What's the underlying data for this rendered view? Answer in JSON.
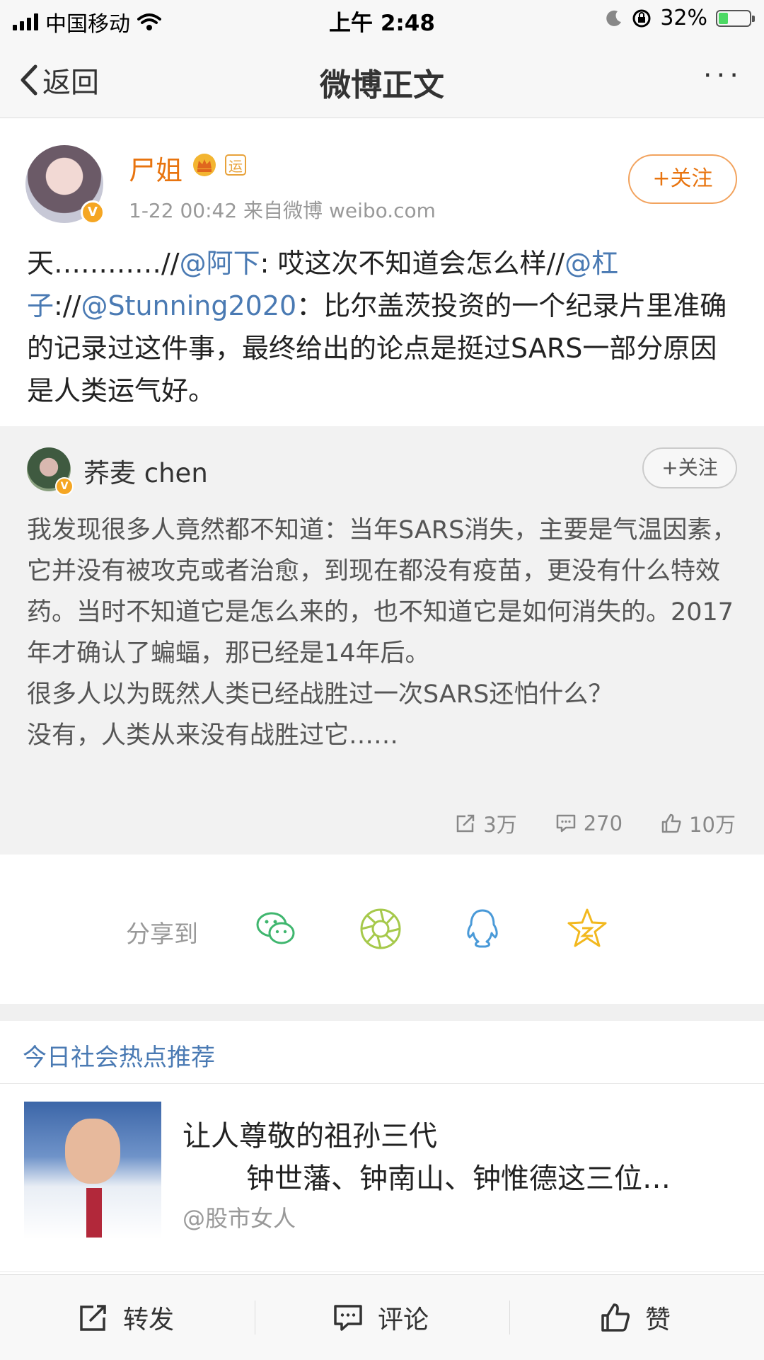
{
  "status": {
    "carrier": "中国移动",
    "time": "上午 2:48",
    "battery": "32%",
    "battery_level": 0.32
  },
  "nav": {
    "back_label": "返回",
    "title": "微博正文",
    "more_label": "···"
  },
  "post": {
    "author": "尸姐",
    "verified_badge": "V",
    "yun_badge": "运",
    "meta": "1-22 00:42  来自微博 weibo.com",
    "follow_label": "+关注",
    "text_parts": [
      {
        "t": "天…………//",
        "m": false
      },
      {
        "t": "@阿下",
        "m": true
      },
      {
        "t": ": 哎这次不知道会怎么样//",
        "m": false
      },
      {
        "t": "@杠子",
        "m": true
      },
      {
        "t": "://",
        "m": false
      },
      {
        "t": "@Stunning2020",
        "m": true
      },
      {
        "t": "：比尔盖茨投资的一个纪录片里准确的记录过这件事，最终给出的论点是挺过SARS一部分原因是人类运气好。",
        "m": false
      }
    ]
  },
  "retweet": {
    "author": "荞麦 chen",
    "follow_label": "+关注",
    "text": "我发现很多人竟然都不知道：当年SARS消失，主要是气温因素，它并没有被攻克或者治愈，到现在都没有疫苗，更没有什么特效药。当时不知道它是怎么来的，也不知道它是如何消失的。2017年才确认了蝙蝠，那已经是14年后。\n很多人以为既然人类已经战胜过一次SARS还怕什么？\n没有，人类从来没有战胜过它……",
    "reposts": "3万",
    "comments": "270",
    "likes": "10万"
  },
  "share": {
    "label": "分享到",
    "targets": [
      "wechat-icon",
      "moments-icon",
      "qq-icon",
      "qzone-icon"
    ]
  },
  "recommend": {
    "header": "今日社会热点推荐",
    "title": "让人尊敬的祖孙三代",
    "subtitle": "钟世藩、钟南山、钟惟德这三位…",
    "author": "@股市女人"
  },
  "toolbar": {
    "repost": "转发",
    "comment": "评论",
    "like": "赞"
  },
  "colors": {
    "accent_orange": "#e8740f",
    "link_blue": "#4a7ab3",
    "wechat_green": "#3fb66e",
    "moments_green": "#a6c94b",
    "qq_blue": "#4a9ad8",
    "qzone_yellow": "#f2b81e"
  }
}
